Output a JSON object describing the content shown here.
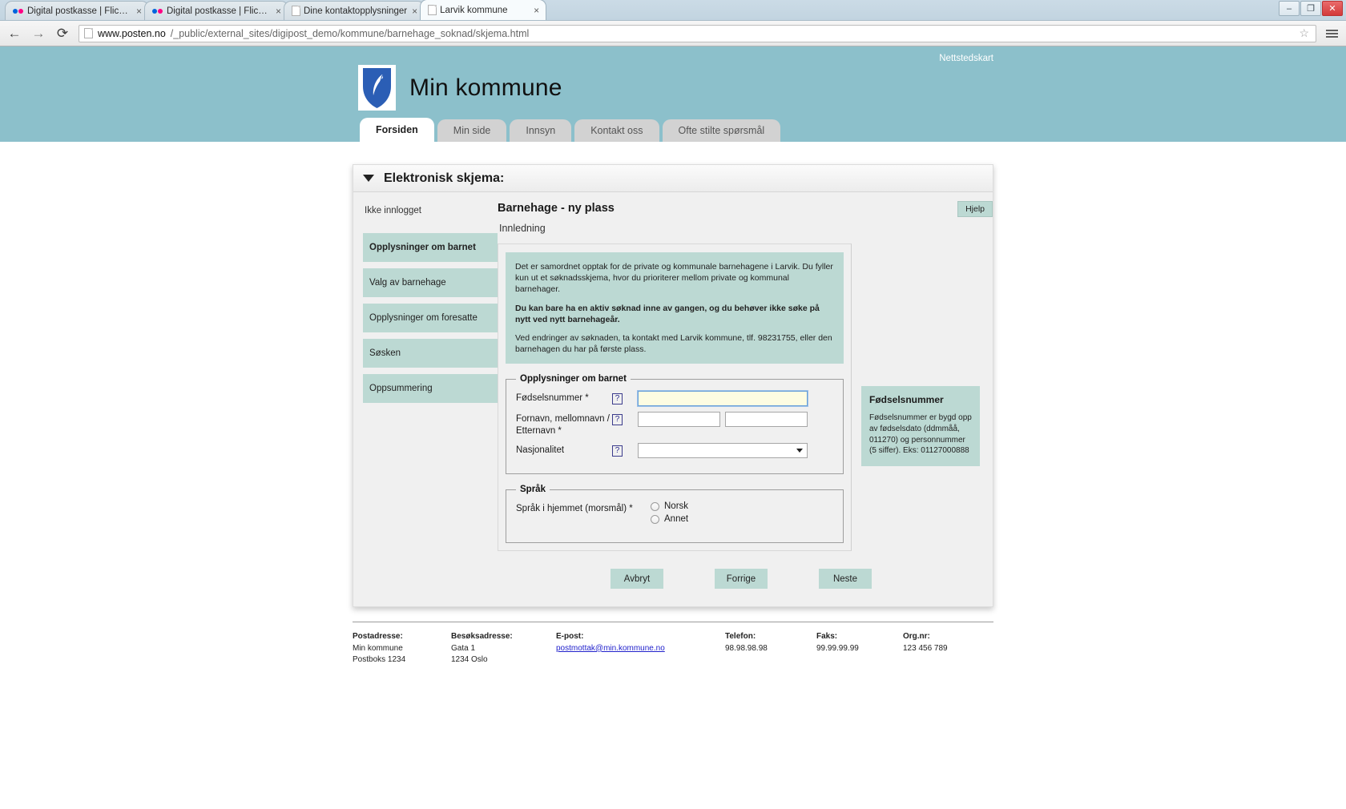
{
  "browser": {
    "tabs": [
      {
        "title": "Digital postkasse | Flickr -",
        "favicon": "flickr-icon",
        "active": false
      },
      {
        "title": "Digital postkasse | Flickr -",
        "favicon": "flickr-icon",
        "active": false
      },
      {
        "title": "Dine kontaktopplysninger",
        "favicon": "page-icon",
        "active": false
      },
      {
        "title": "Larvik kommune",
        "favicon": "page-icon",
        "active": true
      }
    ],
    "close_label": "×",
    "window_controls": {
      "minimize": "–",
      "maximize": "❐",
      "close": "✕"
    },
    "nav": {
      "back": "←",
      "forward": "→",
      "reload": "⟳"
    },
    "url_strong": "www.posten.no",
    "url_rest": "/_public/external_sites/digipost_demo/kommune/barnehage_soknad/skjema.html",
    "star": "☆"
  },
  "header": {
    "site_title": "Min kommune",
    "sitemap_link": "Nettstedskart",
    "nav_tabs": [
      {
        "label": "Forsiden",
        "active": true
      },
      {
        "label": "Min side",
        "active": false
      },
      {
        "label": "Innsyn",
        "active": false
      },
      {
        "label": "Kontakt oss",
        "active": false
      },
      {
        "label": "Ofte stilte spørsmål",
        "active": false
      }
    ]
  },
  "card": {
    "title": "Elektronisk skjema:",
    "help_button": "Hjelp",
    "login_state": "Ikke innlogget",
    "sidebar_items": [
      {
        "label": "Opplysninger om barnet",
        "current": true
      },
      {
        "label": "Valg av barnehage",
        "current": false
      },
      {
        "label": "Opplysninger om foresatte",
        "current": false
      },
      {
        "label": "Søsken",
        "current": false
      },
      {
        "label": "Oppsummering",
        "current": false
      }
    ],
    "form_title": "Barnehage - ny plass",
    "step_label": "Innledning",
    "info": {
      "p1": "Det er samordnet opptak for de private og kommunale barnehagene i Larvik. Du fyller kun ut et søknadsskjema, hvor du prioriterer mellom private og kommunal barnehager.",
      "p2": "Du kan bare ha en aktiv søknad inne av gangen, og du behøver ikke søke på nytt ved nytt barnehageår.",
      "p3": "Ved endringer av søknaden, ta kontakt med Larvik kommune, tlf. 98231755, eller den barnehagen du har på første plass."
    },
    "fieldset_child": {
      "legend": "Opplysninger om barnet",
      "fodselsnummer_label": "Fødselsnummer *",
      "fodselsnummer_value": "",
      "navn_label": "Fornavn, mellomnavn / Etternavn *",
      "fornavn_value": "",
      "etternavn_value": "",
      "nasjonalitet_label": "Nasjonalitet",
      "nasjonalitet_value": "",
      "help_icon": "?"
    },
    "fieldset_language": {
      "legend": "Språk",
      "question_label": "Språk i hjemmet (morsmål) *",
      "options": [
        {
          "label": "Norsk",
          "selected": false
        },
        {
          "label": "Annet",
          "selected": false
        }
      ]
    },
    "help_card": {
      "title": "Fødselsnummer",
      "body": "Fødselsnummer er bygd opp av fødselsdato (ddmmåå, 011270) og personnummer (5 siffer). Eks: 01127000888"
    },
    "buttons": [
      {
        "label": "Avbryt"
      },
      {
        "label": "Forrige"
      },
      {
        "label": "Neste"
      }
    ]
  },
  "footer": {
    "columns": [
      {
        "heading": "Postadresse:",
        "lines": [
          "Min kommune",
          "Postboks 1234"
        ],
        "link": ""
      },
      {
        "heading": "Besøksadresse:",
        "lines": [
          "Gata 1",
          "1234 Oslo"
        ],
        "link": ""
      },
      {
        "heading": "E-post:",
        "lines": [],
        "link": "postmottak@min.kommune.no"
      },
      {
        "heading": "Telefon:",
        "lines": [
          "98.98.98.98"
        ],
        "link": ""
      },
      {
        "heading": "Faks:",
        "lines": [
          "99.99.99.99"
        ],
        "link": ""
      },
      {
        "heading": "Org.nr:",
        "lines": [
          "123 456 789"
        ],
        "link": ""
      }
    ]
  },
  "colors": {
    "header_bg": "#8cc0cb",
    "accent_teal": "#bcd9d3",
    "focus_yellow": "#fdfce2",
    "link_blue": "#2222cc"
  }
}
